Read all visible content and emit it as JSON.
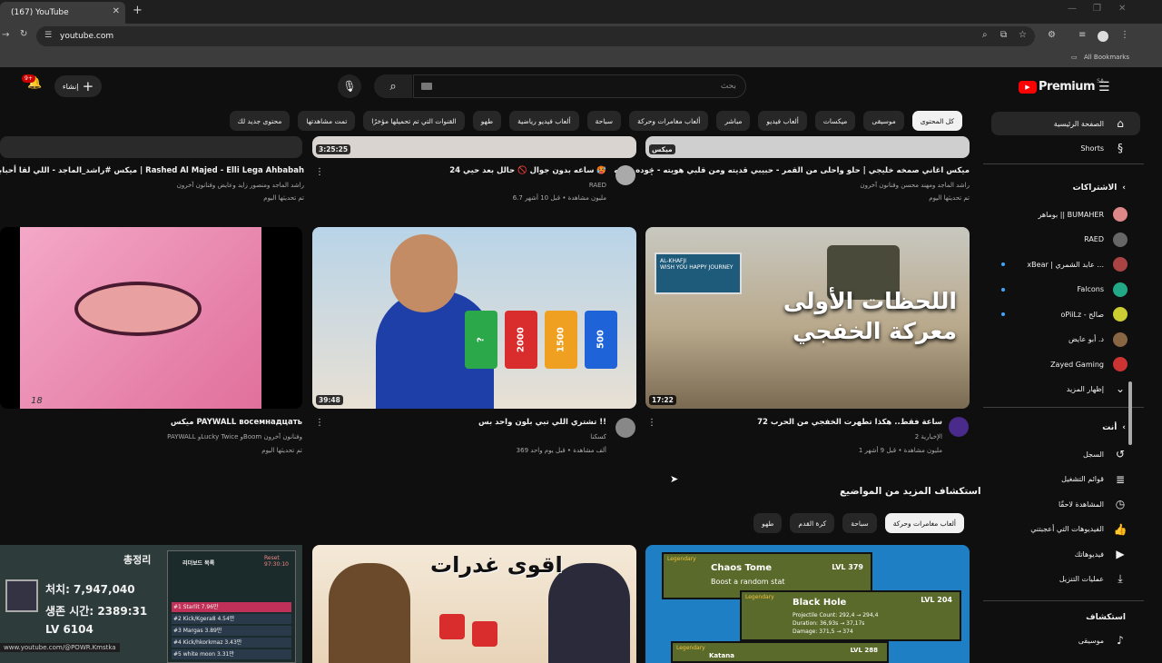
{
  "browser": {
    "tab_title": "(167) YouTube",
    "url": "youtube.com",
    "bookmarks_label": "All Bookmarks"
  },
  "header": {
    "brand": "Premium",
    "region": "SA",
    "search_placeholder": "بحث",
    "create_label": "إنشاء",
    "notif_count": "9+"
  },
  "chips": [
    "كل المحتوى",
    "موسيقى",
    "ميكسات",
    "ألعاب فيديو",
    "مباشر",
    "ألعاب مغامرات وحركة",
    "سباحة",
    "ألعاب فيديو رياضية",
    "طهو",
    "القنوات التي تم تحميلها مؤخرًا",
    "تمت مشاهدتها",
    "محتوى جديد لك"
  ],
  "sidebar": {
    "main": [
      {
        "label": "الصفحة الرئيسية",
        "icon": "home-icon"
      },
      {
        "label": "Shorts",
        "icon": "shorts-icon"
      }
    ],
    "subs_title": "الاشتراكات",
    "subs": [
      {
        "label": "بوماهر || BUMAHER",
        "color": "#d88",
        "dot": false
      },
      {
        "label": "RAED",
        "color": "#666",
        "dot": false
      },
      {
        "label": "xBear | عابد الشمري ...",
        "color": "#a44",
        "dot": true
      },
      {
        "label": "Falcons",
        "color": "#2a8",
        "dot": true
      },
      {
        "label": "oPiiLz - صالح",
        "color": "#cc3",
        "dot": true
      },
      {
        "label": "د. أبو عايض",
        "color": "#864",
        "dot": false
      },
      {
        "label": "Zayed Gaming",
        "color": "#c33",
        "dot": false
      }
    ],
    "show_more": "إظهار المزيد",
    "you_title": "أنت",
    "you": [
      {
        "label": "السجل",
        "icon": "history-icon"
      },
      {
        "label": "قوائم التشغيل",
        "icon": "playlist-icon"
      },
      {
        "label": "المشاهدة لاحقًا",
        "icon": "clock-icon"
      },
      {
        "label": "الفيديوهات التي أعجبتني",
        "icon": "like-icon"
      },
      {
        "label": "فيديوهاتك",
        "icon": "your-videos-icon"
      },
      {
        "label": "عمليات التنزيل",
        "icon": "download-icon"
      }
    ],
    "explore_title": "استكشاف",
    "explore": [
      {
        "label": "موسيقى",
        "icon": "music-icon"
      }
    ]
  },
  "row1": [
    {
      "title": "ميكس اغاني صمخه خليجي | حلو واحلى من القمر - حبيبي قديته ومن قلبي هويته - جوده عاليه",
      "meta1": "راشد الماجد ومهند محسن وفنانون آخرون",
      "meta2": "تم تحديثها اليوم",
      "tag": "ميكس"
    },
    {
      "title": "24 ساعه بدون جوال 🚫 حالل بعد حيي 🥵",
      "meta1": "RAED",
      "meta2": "6.7 مليون مشاهدة • قبل 10 أشهر",
      "duration": "3:25:25"
    },
    {
      "title": "ميكس #راشد_الماجد - اللي لقا أحبابه | Rashed Al Majed - Elli Lega Ahbabah",
      "meta1": "راشد الماجد ومنصور زايد وعايض وفنانون آخرون",
      "meta2": "تم تحديثها اليوم"
    }
  ],
  "row2": [
    {
      "title": "72 ساعة فقط.. هكذا تطهرت الخفجي من الحرب",
      "meta1": "الإخبارية 2",
      "meta2": "1 مليون مشاهدة • قبل 9 أشهر",
      "duration": "17:22",
      "overlay": "اللحظات الأولى\nمعركة الخفجي",
      "sign": "AL-KHAFJI\nWISH YOU HAPPY JOURNEY"
    },
    {
      "title": "تشتري اللي تبي بلون واحد بس !!",
      "meta1": "كسكنا",
      "meta2": "369 ألف مشاهدة • قبل يوم واحد",
      "duration": "39:48",
      "nums": [
        "?",
        "2000",
        "1500",
        "500"
      ]
    },
    {
      "title": "ميكس PAYWALL восемнадцать",
      "meta1": "PAYWALL وLucky Twice وBoom وفنانون آخرون",
      "meta2": "تم تحديثها اليوم",
      "num": "18"
    }
  ],
  "explore_more": "استكشاف المزيد من المواضيع",
  "explore_chips": [
    "ألعاب مغامرات وحركة",
    "سباحة",
    "كرة القدم",
    "طهو"
  ],
  "row3": {
    "game": {
      "tag1": "Legendary",
      "title1": "Chaos Tome",
      "sub1": "Boost a random stat",
      "lvl1": "LVL 379",
      "tag2": "Legendary",
      "title2": "Black Hole",
      "lvl2": "LVL 204",
      "stats": [
        "Projectile Count: 292,4 → 294,4",
        "Duration: 36,93s → 37,17s",
        "Damage: 371,5 → 374"
      ],
      "tag3": "Legendary",
      "title3": "Katana",
      "lvl3": "LVL 288"
    },
    "poster": {
      "text": "اقوى غدرات"
    },
    "korean": {
      "h1": "총정리",
      "l1": "처치: 7,947,040",
      "l2": "생존 시간: 2389:31",
      "l3": "LV 6104",
      "board": "리더보드 목록",
      "reset": "Reset 97:30:10",
      "rows": [
        "#1 Starlit 7.96만",
        "#2 Kick/Kgera8 4.54만",
        "#3 Margas 3.89만",
        "#4 Kick/hkorkmaz 3.43만",
        "#5 white moon 3.31만"
      ]
    }
  },
  "status_url": "www.youtube.com/@POWR.Kmstka"
}
